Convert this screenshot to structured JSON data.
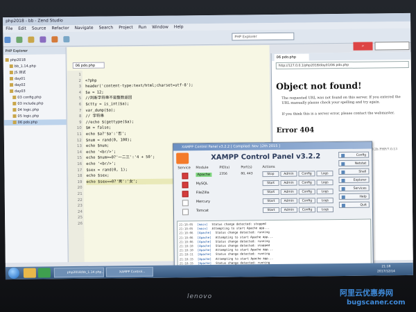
{
  "ide": {
    "title": "php2018 - bb - Zend Studio",
    "menu": [
      "File",
      "Edit",
      "Source",
      "Refactor",
      "Navigate",
      "Search",
      "Project",
      "Run",
      "Window",
      "Help"
    ],
    "search_value": "PHP Explorer",
    "explorer_title": "PHP Explorer",
    "tree": [
      "php2018",
      "bb_1.14.php",
      "JS 测试",
      "day01",
      "day02",
      "day03",
      "03 config.php",
      "03 include.php",
      "04 logic.php",
      "05 logic.php",
      "06 pdo.php"
    ],
    "selected_index": 10,
    "tab": "06 pdo.php",
    "lines": [
      "",
      "<?php",
      "header('content-type:text/html;charset=utf-8');",
      "$a = 12;",
      "//判断字符串不是整数返回  ",
      "$ctty = is_int($a);",
      "var_dump($a);",
      "// 字符串",
      "//echo  $(gettype($a);",
      "$m = false;",
      "echo $a?'$a':'否';",
      "$num = rand(0, 100);",
      "echo $num;",
      "echo '<br/>';",
      "echo $num>=0?'一二三':'4 + 50';",
      "echo '<br/>';",
      "$sex = rand(0, 1);",
      "echo $sex;",
      "echo $sex==0?'男':'女';",
      "",
      "",
      "",
      "",
      "",
      "",
      ""
    ],
    "current_line": 18
  },
  "browser": {
    "tab": "06 pdo.php",
    "url": "http://127.0.0.1/php2018/day01/06 pdo.php",
    "error_title": "Object not found!",
    "error_text_1": "The requested URL was not found on this server. If you entered the URL manually please check your spelling and try again.",
    "error_text_2": "If you think this is a server error, please contact the webmaster.",
    "error_code": "Error 404",
    "host_line": "localhost  Apache/2.4.23 (Win32) OpenSSL/1.0.2h PHP/7.0.13"
  },
  "xampp": {
    "title": "XAMPP Control Panel v3.2.2   [ Compiled: Nov 12th 2015 ]",
    "heading": "XAMPP Control Panel v3.2.2",
    "columns": {
      "service": "Service",
      "module": "Module",
      "pids": "PID(s)",
      "ports": "Port(s)",
      "actions": "Actions"
    },
    "modules": [
      {
        "name": "Apache",
        "pid": "2356",
        "port": "80, 443",
        "running": true
      },
      {
        "name": "MySQL",
        "pid": "",
        "port": "",
        "running": false
      },
      {
        "name": "FileZilla",
        "pid": "",
        "port": "",
        "running": false
      },
      {
        "name": "Mercury",
        "pid": "",
        "port": "",
        "running": false
      },
      {
        "name": "Tomcat",
        "pid": "",
        "port": "",
        "running": false
      }
    ],
    "actions": {
      "stop": "Stop",
      "start": "Start",
      "admin": "Admin",
      "config": "Config",
      "logs": "Logs"
    },
    "side_buttons": [
      "Config",
      "Netstat",
      "Shell",
      "Explorer",
      "Services",
      "Help",
      "Quit"
    ],
    "log": [
      {
        "time": "21:18:05",
        "module": "[main]",
        "msg": "Status change detected: stopped"
      },
      {
        "time": "21:18:05",
        "module": "[main]",
        "msg": "Attempting to start Apache app..."
      },
      {
        "time": "21:18:06",
        "module": "[Apache]",
        "msg": "Status change detected: running"
      },
      {
        "time": "21:18:06",
        "module": "[Apache]",
        "msg": "Attempting to start Apache app..."
      },
      {
        "time": "21:18:06",
        "module": "[Apache]",
        "msg": "Status change detected: running"
      },
      {
        "time": "21:18:10",
        "module": "[Apache]",
        "msg": "Status change detected: stopped"
      },
      {
        "time": "21:18:10",
        "module": "[Apache]",
        "msg": "Attempting to start Apache app..."
      },
      {
        "time": "21:18:11",
        "module": "[Apache]",
        "msg": "Status change detected: running"
      },
      {
        "time": "21:18:15",
        "module": "[Apache]",
        "msg": "Attempting to start Apache app..."
      },
      {
        "time": "21:18:15",
        "module": "[Apache]",
        "msg": "Status change detected: running"
      }
    ]
  },
  "taskbar": {
    "tasks": [
      "php2018/bb_1.14 php...",
      "XAMPP Control..."
    ],
    "clock_time": "21:18",
    "clock_date": "2017/12/14"
  },
  "bezel": {
    "brand": "lenovo"
  },
  "watermark": {
    "line1": "阿里云优惠券网",
    "line2": "bugscaner.com"
  }
}
